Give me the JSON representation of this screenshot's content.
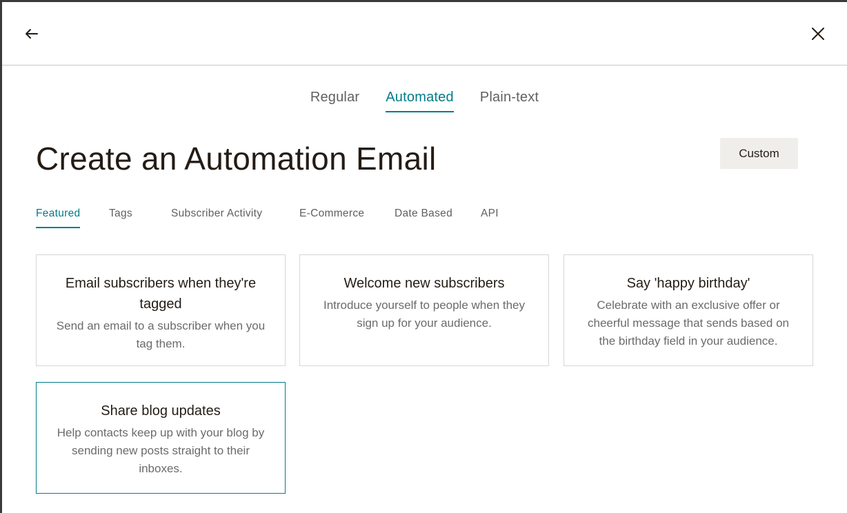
{
  "header": {
    "back_icon": "arrow-left-icon",
    "close_icon": "close-icon"
  },
  "type_tabs": [
    {
      "label": "Regular",
      "active": false
    },
    {
      "label": "Automated",
      "active": true
    },
    {
      "label": "Plain-text",
      "active": false
    }
  ],
  "page": {
    "title": "Create an Automation Email",
    "custom_label": "Custom"
  },
  "category_tabs": [
    {
      "label": "Featured",
      "active": true
    },
    {
      "label": "Tags",
      "active": false
    },
    {
      "label": "Subscriber Activity",
      "active": false
    },
    {
      "label": "E-Commerce",
      "active": false
    },
    {
      "label": "Date Based",
      "active": false
    },
    {
      "label": "API",
      "active": false
    }
  ],
  "cards": [
    {
      "title": "Email subscribers when they're tagged",
      "description": "Send an email to a subscriber when you tag them."
    },
    {
      "title": "Welcome new subscribers",
      "description": "Introduce yourself to people when they sign up for your audience."
    },
    {
      "title": "Say 'happy birthday'",
      "description": "Celebrate with an exclusive offer or cheerful message that sends based on the birthday field in your audience."
    },
    {
      "title": "Share blog updates",
      "description": "Help contacts keep up with your blog by sending new posts straight to their inboxes."
    }
  ],
  "colors": {
    "accent": "#007c89",
    "text": "#241c15",
    "muted": "#606060",
    "button_bg": "#efeeea"
  }
}
